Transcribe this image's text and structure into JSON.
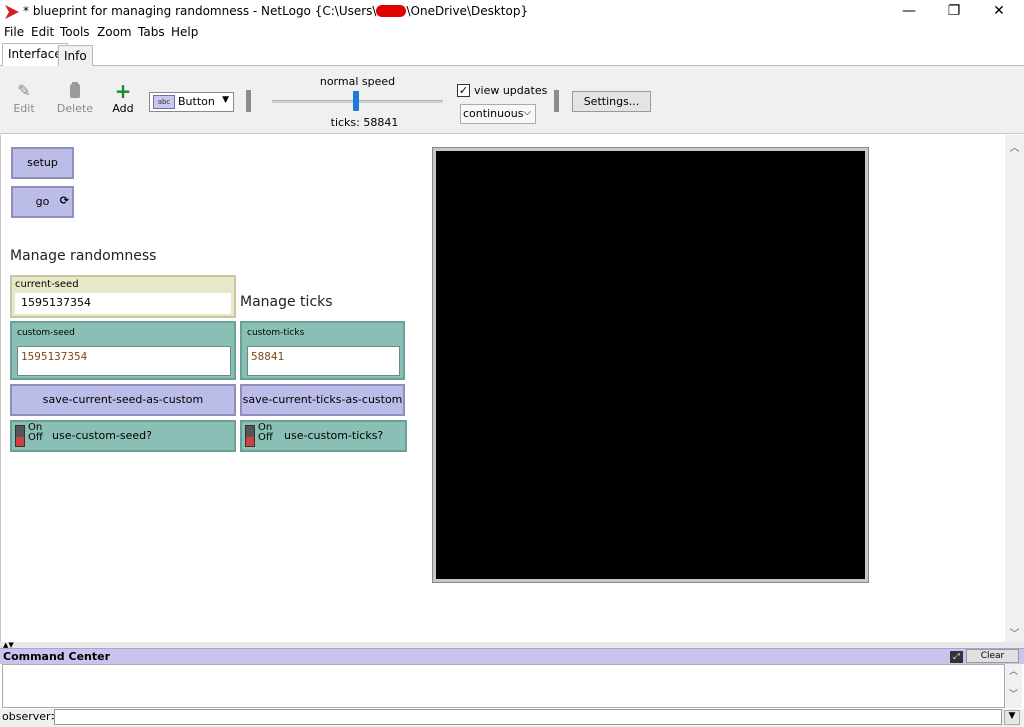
{
  "window": {
    "title_prefix": "* blueprint for managing randomness - NetLogo {C:\\Users\\",
    "title_suffix": "\\OneDrive\\Desktop}",
    "minimize": "—",
    "maximize": "❐",
    "close": "✕"
  },
  "menu": [
    "File",
    "Edit",
    "Tools",
    "Zoom",
    "Tabs",
    "Help"
  ],
  "tabs": [
    "Interface",
    "Info"
  ],
  "toolbar": {
    "edit_label": "Edit",
    "delete_label": "Delete",
    "add_label": "Add",
    "widget_type": "Button",
    "speed_label": "normal speed",
    "ticks_label": "ticks: 58841",
    "view_updates_label": "view updates",
    "view_updates_checked": true,
    "update_mode": "continuous",
    "settings_label": "Settings..."
  },
  "widgets": {
    "setup_label": "setup",
    "go_label": "go",
    "note_randomness": "Manage randomness",
    "note_ticks": "Manage ticks",
    "current_seed": {
      "label": "current-seed",
      "value": "1595137354"
    },
    "custom_seed": {
      "label": "custom-seed",
      "value": "1595137354"
    },
    "custom_ticks": {
      "label": "custom-ticks",
      "value": "58841"
    },
    "save_seed_label": "save-current-seed-as-custom",
    "save_ticks_label": "save-current-ticks-as-custom",
    "switch_on": "On",
    "switch_off": "Off",
    "use_seed_label": "use-custom-seed?",
    "use_ticks_label": "use-custom-ticks?"
  },
  "command_center": {
    "title": "Command Center",
    "clear_label": "Clear",
    "agent_label": "observer>"
  },
  "colors": {
    "button": "#bcbce8",
    "input": "#8abfb5",
    "monitor": "#e8e8c8",
    "view": "#000000",
    "command_header": "#c8c4ee"
  }
}
